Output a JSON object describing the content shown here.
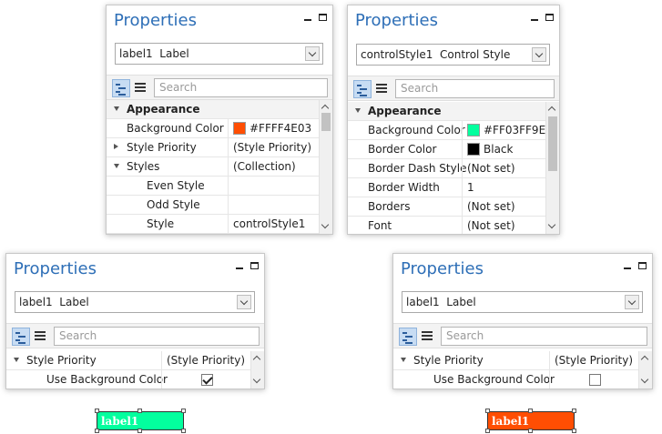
{
  "panel1": {
    "title": "Properties",
    "selector_name": "label1",
    "selector_type": "Label",
    "search_placeholder": "Search",
    "rows": [
      {
        "name": "Appearance",
        "value": ""
      },
      {
        "name": "Background Color",
        "value": "#FFFF4E03"
      },
      {
        "name": "Style Priority",
        "value": "(Style Priority)"
      },
      {
        "name": "Styles",
        "value": "(Collection)"
      },
      {
        "name": "Even Style",
        "value": ""
      },
      {
        "name": "Odd Style",
        "value": ""
      },
      {
        "name": "Style",
        "value": "controlStyle1"
      }
    ],
    "swatch_color": "#FF4E03"
  },
  "panel2": {
    "title": "Properties",
    "selector_name": "controlStyle1",
    "selector_type": "Control Style",
    "search_placeholder": "Search",
    "rows": [
      {
        "name": "Appearance",
        "value": ""
      },
      {
        "name": "Background Color",
        "value": "#FF03FF9E"
      },
      {
        "name": "Border Color",
        "value": "Black"
      },
      {
        "name": "Border Dash Style",
        "value": "(Not set)"
      },
      {
        "name": "Border Width",
        "value": "1"
      },
      {
        "name": "Borders",
        "value": "(Not set)"
      },
      {
        "name": "Font",
        "value": "(Not set)"
      }
    ],
    "swatch_color": "#03FF9E",
    "border_swatch_color": "#000000"
  },
  "panel3": {
    "title": "Properties",
    "selector_name": "label1",
    "selector_type": "Label",
    "search_placeholder": "Search",
    "rows": [
      {
        "name": "Style Priority",
        "value": "(Style Priority)"
      },
      {
        "name": "Use Background Color",
        "value": ""
      }
    ],
    "use_background_color_checked": true
  },
  "panel4": {
    "title": "Properties",
    "selector_name": "label1",
    "selector_type": "Label",
    "search_placeholder": "Search",
    "rows": [
      {
        "name": "Style Priority",
        "value": "(Style Priority)"
      },
      {
        "name": "Use Background Color",
        "value": ""
      }
    ],
    "use_background_color_checked": false
  },
  "label_controls": [
    {
      "text": "label1",
      "color": "#03FF9E"
    },
    {
      "text": "label1",
      "color": "#FF4E03"
    }
  ]
}
